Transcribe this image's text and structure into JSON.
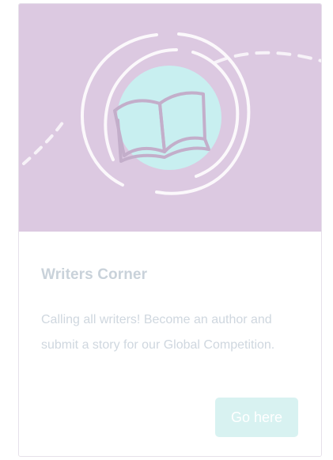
{
  "card": {
    "title": "Writers Corner",
    "description": "Calling all writers! Become an author and submit a story for our Global Competition.",
    "button_label": "Go here",
    "icon": "open-book-icon"
  },
  "colors": {
    "hero_background": "#dcc9e1",
    "icon_circle": "#c8eff0",
    "title_text": "#c9d2da",
    "body_text": "#cfd7df",
    "button_background": "#d8f2f1"
  }
}
